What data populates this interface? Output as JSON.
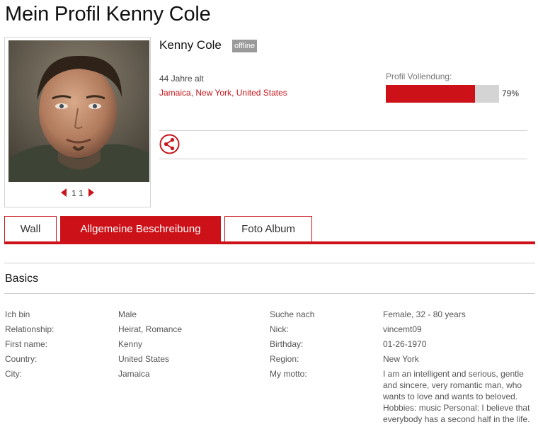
{
  "page": {
    "title": "Mein Profil Kenny Cole"
  },
  "photo": {
    "counter": "1 1"
  },
  "profile": {
    "name": "Kenny Cole",
    "status": "offline",
    "age": "44 Jahre alt",
    "location": {
      "city": "Jamaica",
      "state": "New York",
      "country": "United States",
      "separator": ", "
    },
    "completion_label": "Profil Vollendung:",
    "completion_value": 0.79,
    "completion_text": "79%"
  },
  "colors": {
    "accent": "#cc1118",
    "track": "#d4d4d4",
    "badge": "#9a9a9a"
  },
  "icons": {
    "share": "share-icon",
    "prev": "chevron-left-icon",
    "next": "chevron-right-icon"
  },
  "tabs": [
    {
      "label": "Wall",
      "active": false
    },
    {
      "label": "Allgemeine Beschreibung",
      "active": true
    },
    {
      "label": "Foto Album",
      "active": false
    }
  ],
  "section": {
    "title": "Basics"
  },
  "details": {
    "left": [
      {
        "label": "Ich bin",
        "value": "Male"
      },
      {
        "label": "Relationship:",
        "value": "Heirat, Romance"
      },
      {
        "label": "First name:",
        "value": "Kenny"
      },
      {
        "label": "Country:",
        "value": "United States"
      },
      {
        "label": "City:",
        "value": "Jamaica"
      }
    ],
    "right": [
      {
        "label": "Suche nach",
        "value": "Female, 32 - 80 years"
      },
      {
        "label": "Nick:",
        "value": "vincemt09"
      },
      {
        "label": "Birthday:",
        "value": "01-26-1970"
      },
      {
        "label": "Region:",
        "value": "New York"
      },
      {
        "label": "My motto:",
        "value": "I am an intelligent and serious, gentle and sincere, very romantic man, who wants to love and wants to beloved. Hobbies: music Personal: I believe that everybody has a second half in the life."
      }
    ]
  }
}
